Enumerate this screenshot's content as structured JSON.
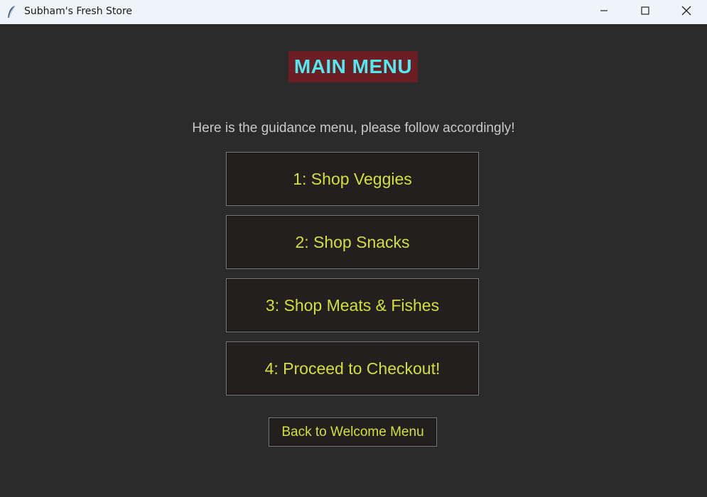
{
  "window": {
    "title": "Subham's Fresh Store",
    "app_icon": "feather-icon",
    "controls": [
      "minimize-icon",
      "maximize-icon",
      "close-icon"
    ]
  },
  "main": {
    "title": "MAIN MENU",
    "guidance": "Here is the guidance menu, please follow accordingly!",
    "options": [
      {
        "label": "1: Shop Veggies"
      },
      {
        "label": "2: Shop Snacks"
      },
      {
        "label": "3: Shop Meats & Fishes"
      },
      {
        "label": "4: Proceed to Checkout!"
      }
    ],
    "back_label": "Back to Welcome Menu"
  },
  "colors": {
    "background": "#2b2b2b",
    "title_bg": "#6b1e24",
    "title_text": "#4fe9ef",
    "button_bg": "#231f1f",
    "button_text": "#d4df3a",
    "guidance_text": "#c9c9c9"
  }
}
